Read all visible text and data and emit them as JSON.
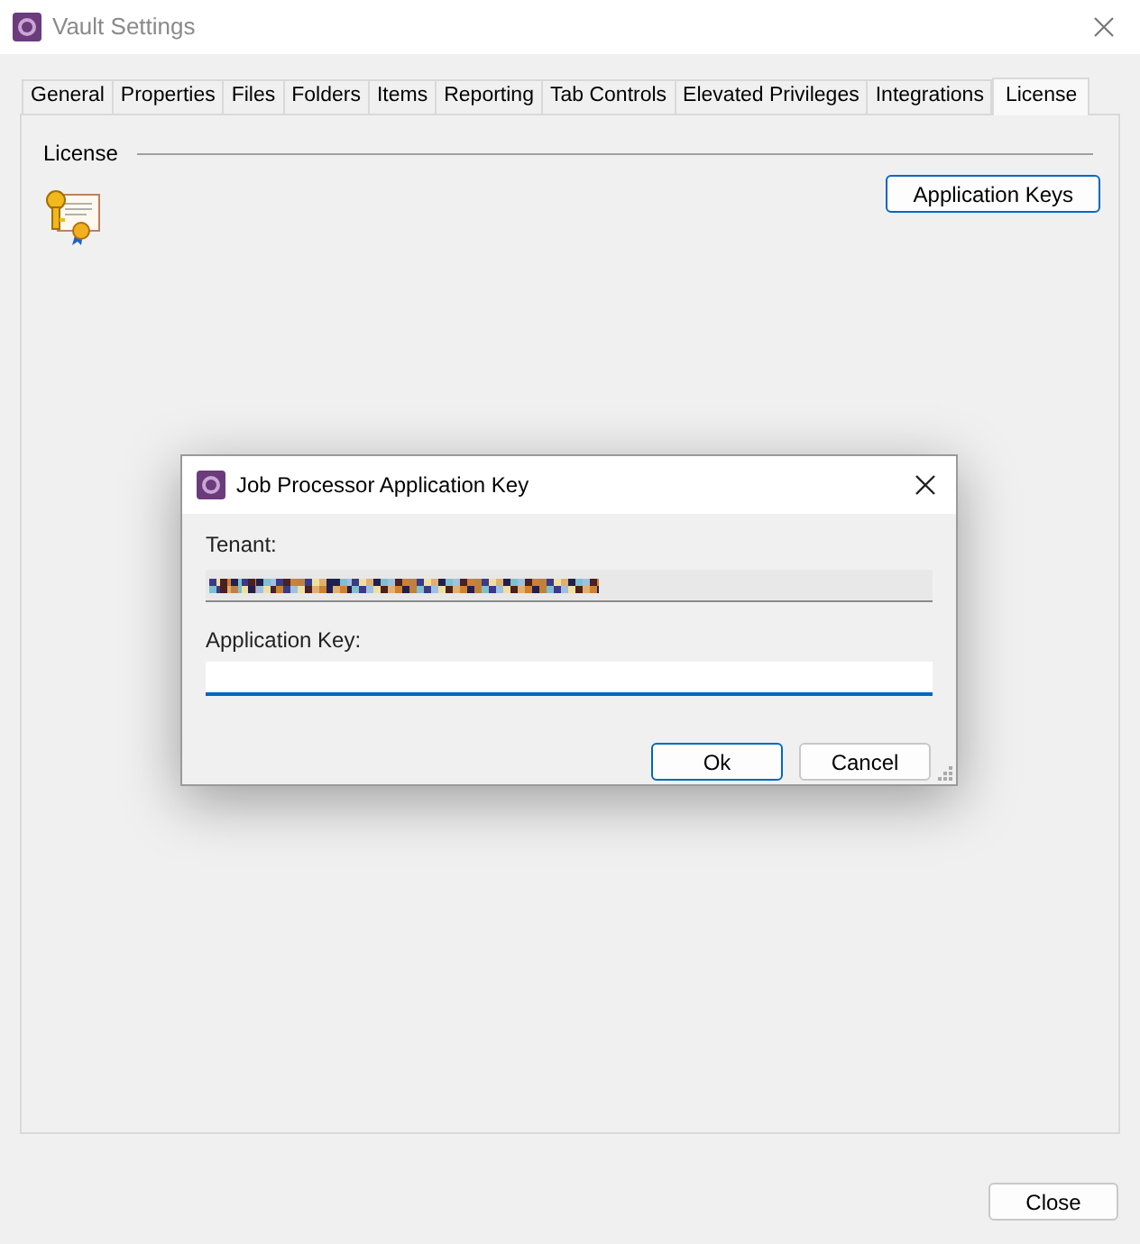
{
  "window": {
    "title": "Vault Settings"
  },
  "tabs": [
    {
      "label": "General",
      "selected": false
    },
    {
      "label": "Properties",
      "selected": false
    },
    {
      "label": "Files",
      "selected": false
    },
    {
      "label": "Folders",
      "selected": false
    },
    {
      "label": "Items",
      "selected": false
    },
    {
      "label": "Reporting",
      "selected": false
    },
    {
      "label": "Tab Controls",
      "selected": false
    },
    {
      "label": "Elevated Privileges",
      "selected": false
    },
    {
      "label": "Integrations",
      "selected": false
    },
    {
      "label": "License",
      "selected": true
    }
  ],
  "license_section": {
    "heading": "License",
    "button": "Application Keys"
  },
  "dialog": {
    "title": "Job Processor Application Key",
    "tenant_label": "Tenant:",
    "key_label": "Application Key:",
    "buttons": [
      {
        "label": "Ok",
        "default": true
      },
      {
        "label": "Cancel",
        "default": false
      }
    ]
  },
  "footer": {
    "button": "Close"
  }
}
